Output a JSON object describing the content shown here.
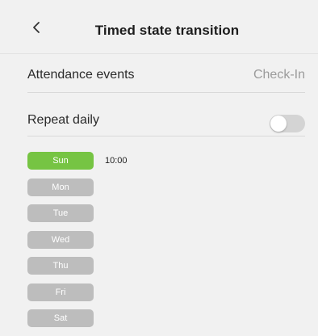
{
  "header": {
    "title": "Timed state transition"
  },
  "attendance": {
    "label": "Attendance events",
    "value": "Check-In"
  },
  "repeat": {
    "label": "Repeat daily",
    "enabled": false
  },
  "days": [
    {
      "label": "Sun",
      "active": true
    },
    {
      "label": "Mon",
      "active": false
    },
    {
      "label": "Tue",
      "active": false
    },
    {
      "label": "Wed",
      "active": false
    },
    {
      "label": "Thu",
      "active": false
    },
    {
      "label": "Fri",
      "active": false
    },
    {
      "label": "Sat",
      "active": false
    }
  ],
  "schedule": {
    "time": "10:00"
  },
  "colors": {
    "active_day": "#76c443",
    "inactive_day": "#bdbdbd",
    "toggle_off": "#d4d4d4"
  }
}
